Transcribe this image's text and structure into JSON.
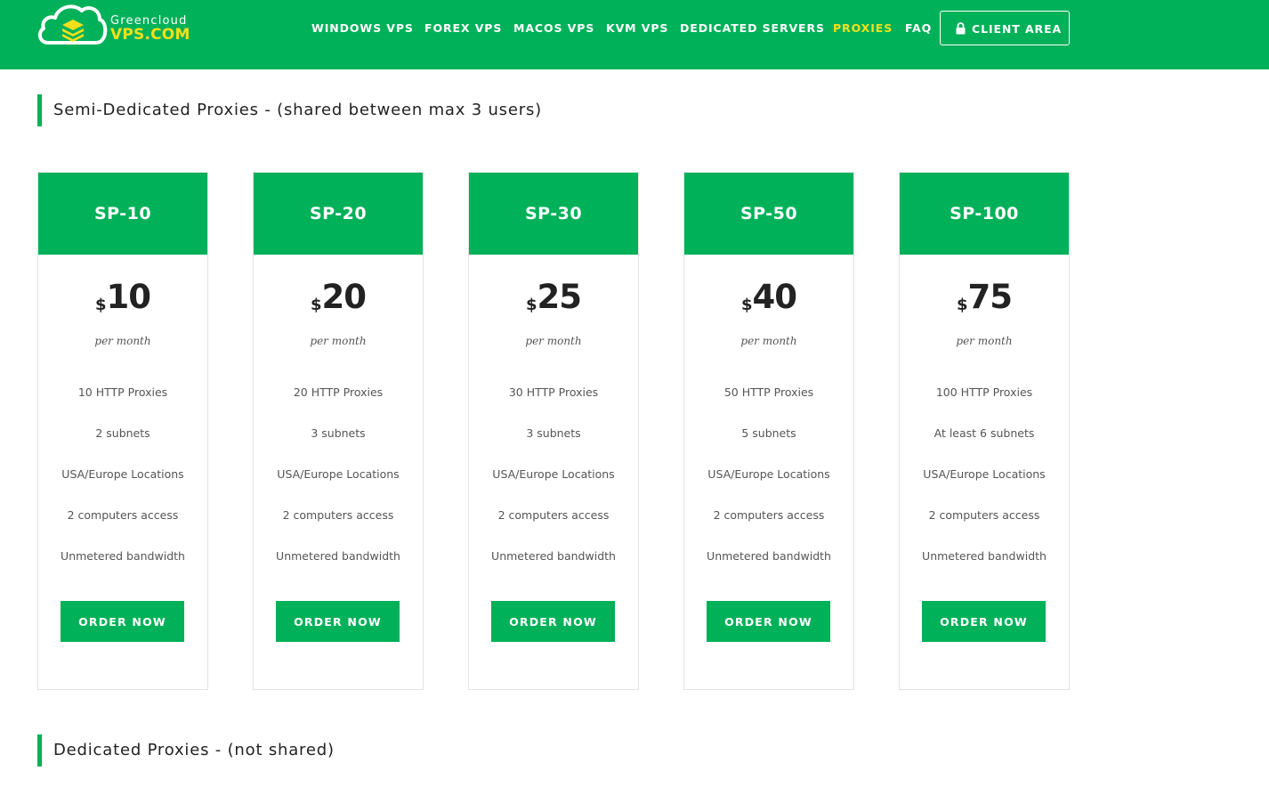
{
  "brand": {
    "small": "Greencloud",
    "big": "VPS.COM"
  },
  "nav": {
    "items": [
      {
        "label": "WINDOWS VPS"
      },
      {
        "label": "FOREX VPS"
      },
      {
        "label": "MACOS VPS"
      },
      {
        "label": "KVM VPS"
      },
      {
        "label": "DEDICATED SERVERS"
      },
      {
        "label": "PROXIES",
        "active": true
      },
      {
        "label": "FAQ"
      }
    ],
    "client_area": "CLIENT AREA"
  },
  "colors": {
    "brand_green": "#00b159",
    "active_yellow": "#f3e01b"
  },
  "sections": {
    "semi_title": "Semi-Dedicated Proxies - (shared between max 3 users)",
    "dedicated_title": "Dedicated Proxies - (not shared)"
  },
  "plans": [
    {
      "name": "SP-10",
      "currency": "$",
      "price": "10",
      "period": "per month",
      "features": [
        "10 HTTP Proxies",
        "2 subnets",
        "USA/Europe Locations",
        "2 computers access",
        "Unmetered bandwidth"
      ],
      "button": "ORDER NOW"
    },
    {
      "name": "SP-20",
      "currency": "$",
      "price": "20",
      "period": "per month",
      "features": [
        "20 HTTP Proxies",
        "3 subnets",
        "USA/Europe Locations",
        "2 computers access",
        "Unmetered bandwidth"
      ],
      "button": "ORDER NOW"
    },
    {
      "name": "SP-30",
      "currency": "$",
      "price": "25",
      "period": "per month",
      "features": [
        "30 HTTP Proxies",
        "3 subnets",
        "USA/Europe Locations",
        "2 computers access",
        "Unmetered bandwidth"
      ],
      "button": "ORDER NOW"
    },
    {
      "name": "SP-50",
      "currency": "$",
      "price": "40",
      "period": "per month",
      "features": [
        "50 HTTP Proxies",
        "5 subnets",
        "USA/Europe Locations",
        "2 computers access",
        "Unmetered bandwidth"
      ],
      "button": "ORDER NOW"
    },
    {
      "name": "SP-100",
      "currency": "$",
      "price": "75",
      "period": "per month",
      "features": [
        "100 HTTP Proxies",
        "At least 6 subnets",
        "USA/Europe Locations",
        "2 computers access",
        "Unmetered bandwidth"
      ],
      "button": "ORDER NOW"
    }
  ]
}
